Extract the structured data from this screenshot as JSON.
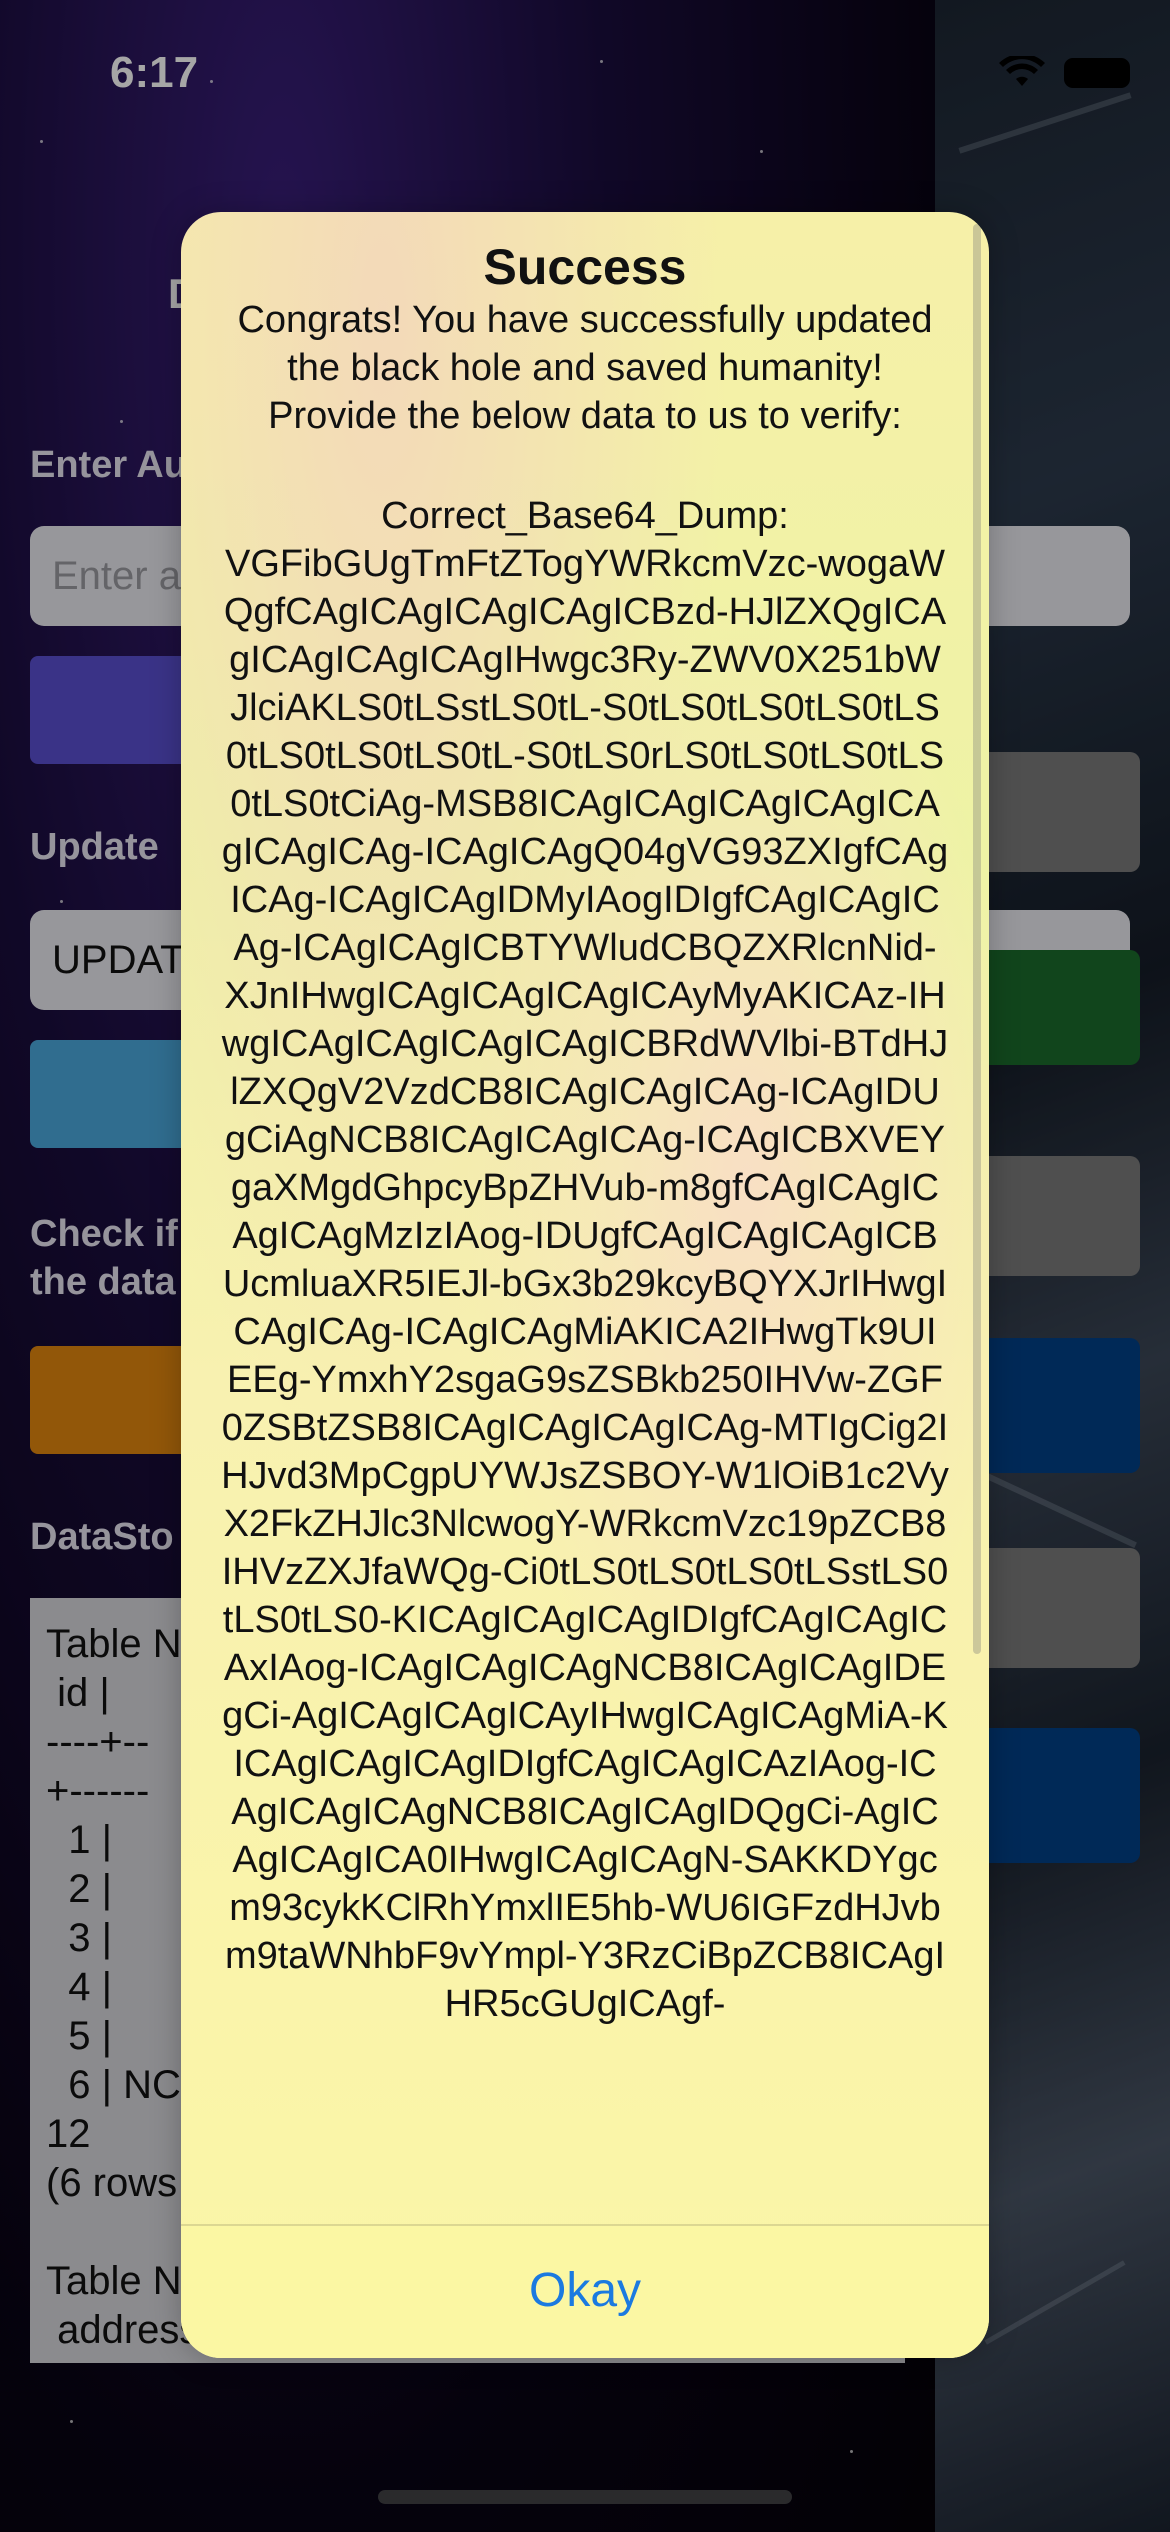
{
  "status_bar": {
    "time": "6:17"
  },
  "background": {
    "title_partial": "D",
    "labels": [
      "Enter Au",
      "Update",
      "Check if\nthe data",
      "DataSto"
    ],
    "input_placeholder": "Enter a",
    "input_value": "UPDAT",
    "datastore_text": "Table N\n id |\n----+--\n+------\n  1 |\n  2 |\n  3 |\n  4 |\n  5 |\n  6 | NC\n12\n(6 rows\n\nTable N\n address id | user_id"
  },
  "colors": {
    "button_purple": "#5a4fd0",
    "button_blue": "#4ba8dc",
    "button_orange": "#e0860f",
    "right_gray": "#7a7a7a",
    "right_green": "#1b6b2b",
    "right_navy": "#003f86",
    "alert_link": "#1b7ae0"
  },
  "alert": {
    "title": "Success",
    "message": "Congrats! You have successfully updated the black hole and saved humanity! Provide the below data to us to verify:",
    "dump_label": "Correct_Base64_Dump:",
    "dump": "VGFibGUgTmFtZTogYWRkcmVzc-wogaWQgfCAgICAgICAgICAgICBzd-HJlZXQgICAgICAgICAgICAgIHwgc3Ry-ZWV0X251bWJlciAKLS0tLSstLS0tL-S0tLS0tLS0tLS0tLS0tLS0tLS0tLS0tL-S0tLS0rLS0tLS0tLS0tLS0tLS0tCiAg-MSB8ICAgICAgICAgICAgICAgICAgICAg-ICAgICAgQ04gVG93ZXIgfCAgICAg-ICAgICAgIDMyIAogIDIgfCAgICAgICAg-ICAgICAgICBTYWludCBQZXRlcnNid-XJnIHwgICAgICAgICAgICAyMyAKICAz-IHwgICAgICAgICAgICAgICBRdWVlbi-BTdHJlZXQgV2VzdCB8ICAgICAgICAg-ICAgIDUgCiAgNCB8ICAgICAgICAg-ICAgICBXVEYgaXMgdGhpcyBpZHVub-m8gfCAgICAgICAgICAgMzIzIAog-IDUgfCAgICAgICAgICBUcmluaXR5IEJl-bGx3b29kcyBQYXJrIHwgICAgICAg-ICAgICAgMiAKICA2IHwgTk9UIEEg-YmxhY2sgaG9sZSBkb250IHVw-ZGF0ZSBtZSB8ICAgICAgICAgICAg-MTIgCig2IHJvd3MpCgpUYWJsZSBOY-W1lOiB1c2VyX2FkZHJlc3NlcwogY-WRkcmVzc19pZCB8IHVzZXJfaWQg-Ci0tLS0tLS0tLS0tLSstLS0tLS0tLS0-KICAgICAgICAgIDIgfCAgICAgICAxIAog-ICAgICAgICAgNCB8ICAgICAgIDEgCi-AgICAgICAgICAyIHwgICAgICAgMiA-KICAgICAgICAgIDIgfCAgICAgICAzIAog-ICAgICAgICAgNCB8ICAgICAgIDQgCi-AgICAgICAgICA0IHwgICAgICAgN-SAKKDYgcm93cykKClRhYmxlIE5hb-WU6IGFzdHJvbm9taWNhbF9vYmpl-Y3RzCiBpZCB8ICAgIHR5cGUgICAgf-",
    "button_label": "Okay"
  }
}
